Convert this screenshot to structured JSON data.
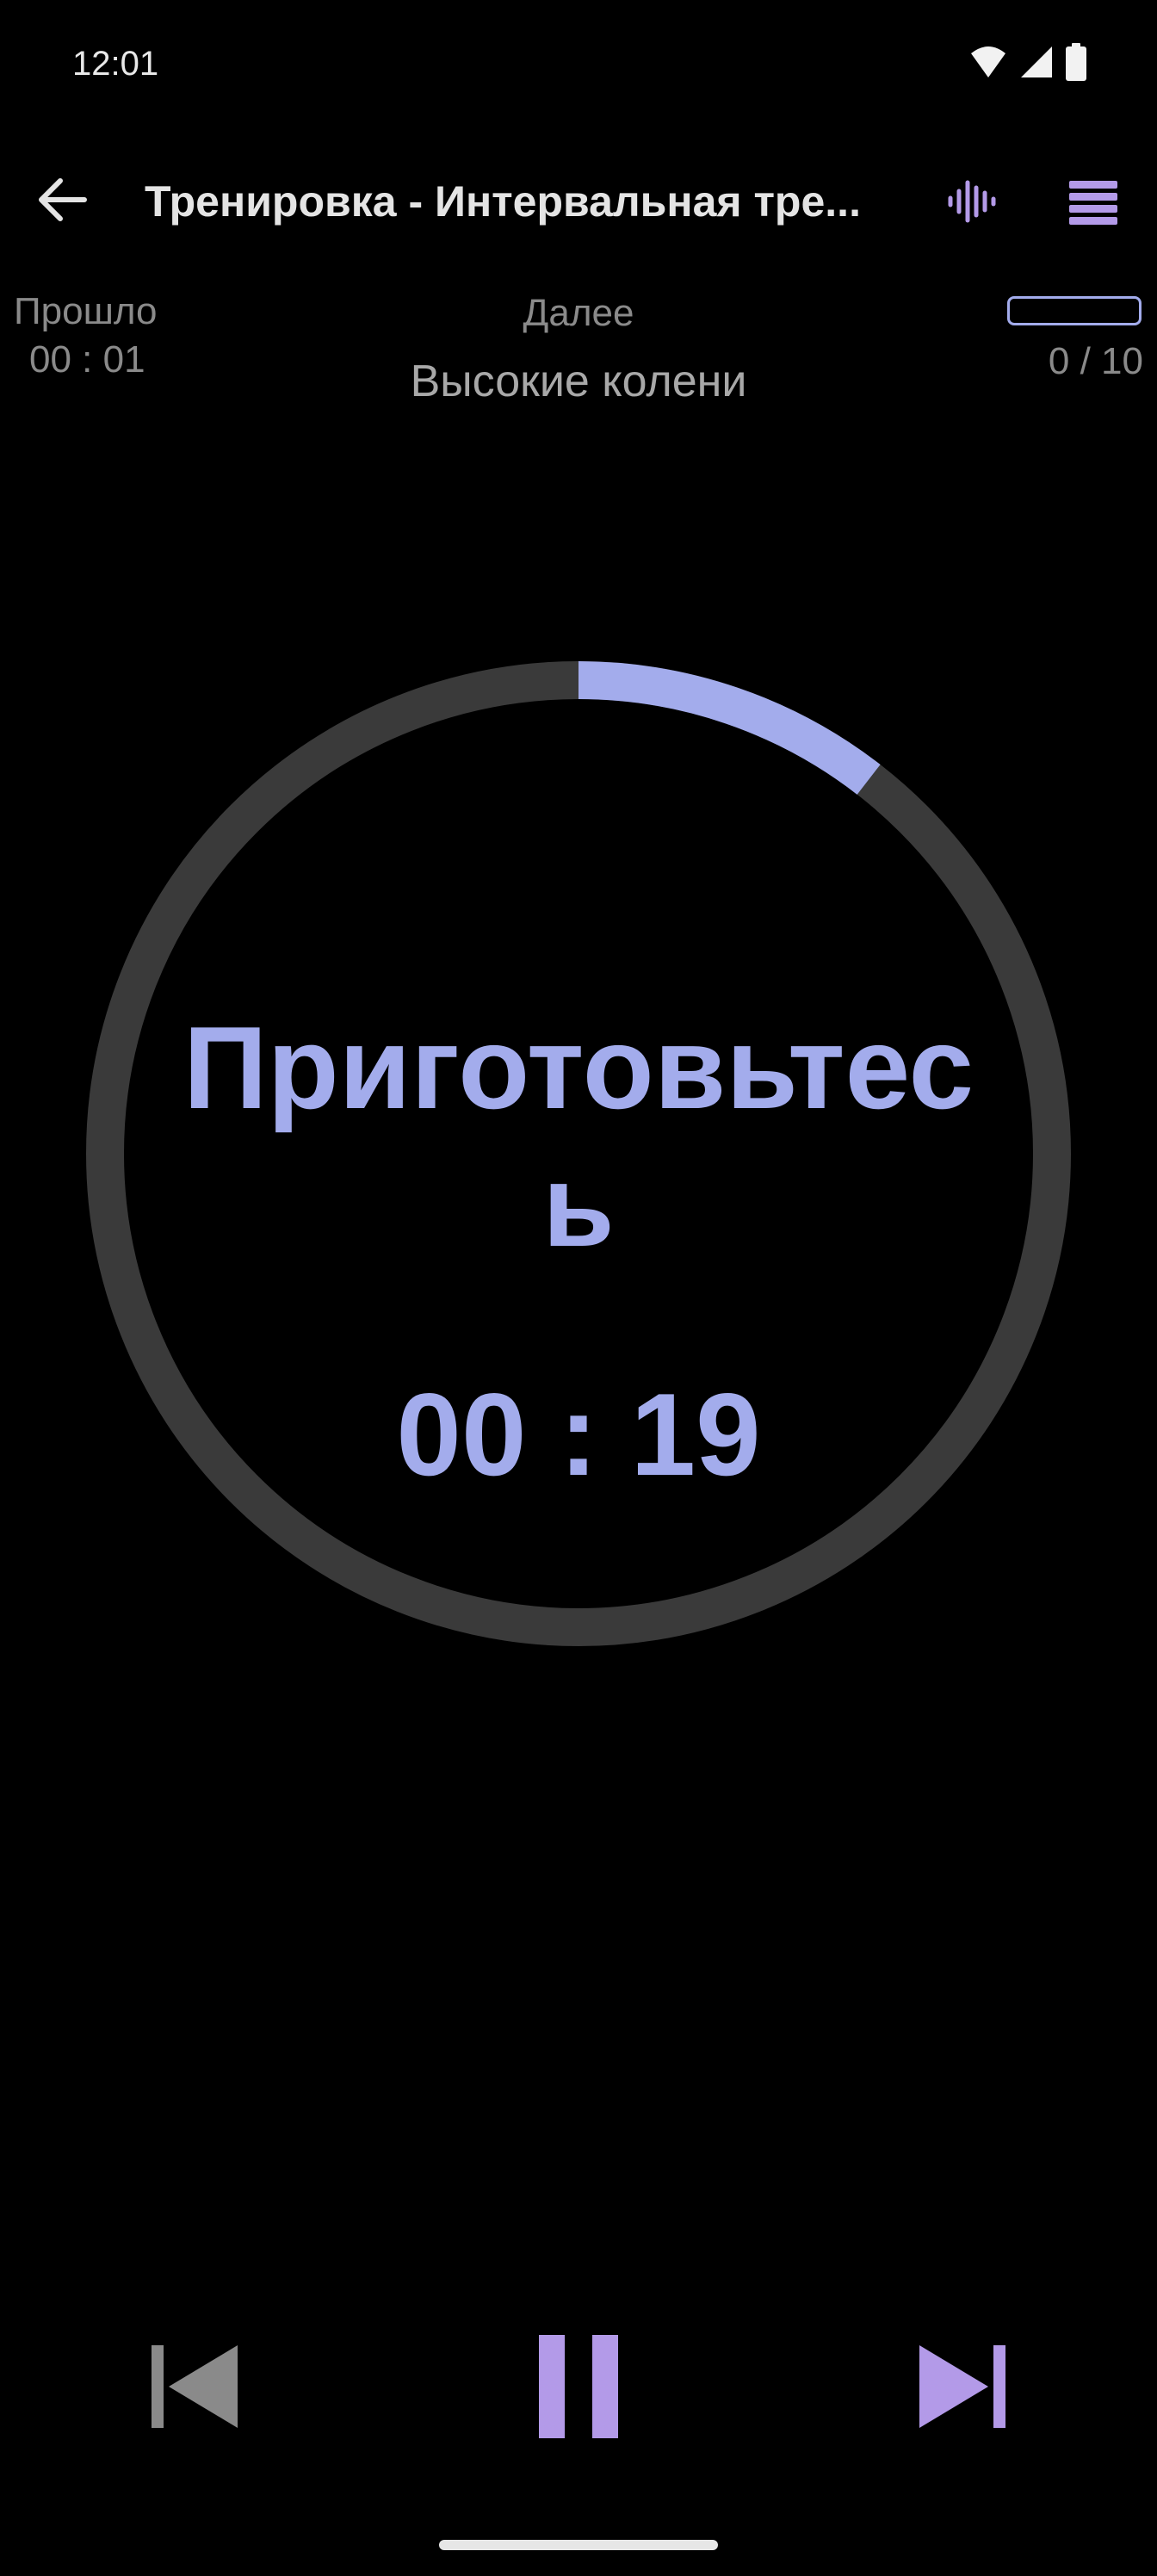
{
  "status_bar": {
    "time": "12:01",
    "icons": [
      "wifi-icon",
      "signal-icon",
      "battery-icon"
    ]
  },
  "app_bar": {
    "title": "Тренировка - Интервальная тре...",
    "back_icon": "arrow-left-icon",
    "sound_icon": "audio-wave-icon",
    "menu_icon": "menu-icon"
  },
  "info": {
    "elapsed_label": "Прошло",
    "elapsed_value": "00 : 01",
    "next_label": "Далее",
    "next_value": "Высокие колени",
    "progress_count": "0 / 10",
    "progress_fraction": 0
  },
  "timer": {
    "phase": "Приготовьтесь",
    "time": "00 : 19",
    "ring_progress_fraction": 0.105
  },
  "controls": {
    "prev_icon": "skip-previous-icon",
    "pause_icon": "pause-icon",
    "next_icon": "skip-next-icon"
  },
  "colors": {
    "accent": "#a3acec",
    "accent_purple": "#b39ae8",
    "ring_track": "#3a3a3a",
    "background": "#000000",
    "disabled": "#8a8a8a"
  }
}
